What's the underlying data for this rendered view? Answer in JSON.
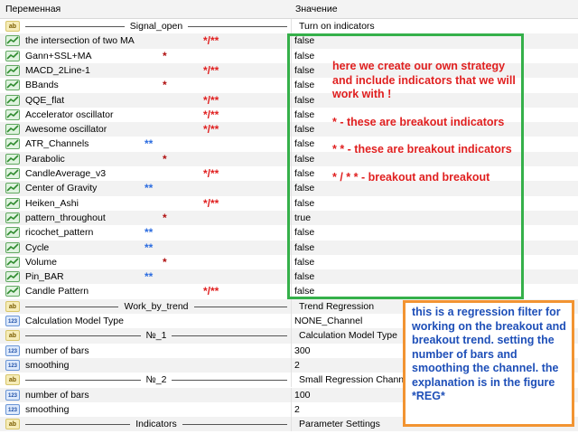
{
  "header": {
    "col_variable": "Переменная",
    "col_value": "Значение"
  },
  "rows": [
    {
      "type": "sep",
      "name": "Signal_open",
      "value": "Turn on indicators"
    },
    {
      "type": "bool",
      "name": "the intersection of two MA",
      "value": "false",
      "mark": "*/**",
      "mark_color": "red"
    },
    {
      "type": "bool",
      "name": "Gann+SSL+MA",
      "value": "false",
      "mark": "*",
      "mark_color": "dark"
    },
    {
      "type": "bool",
      "name": "MACD_2Line-1",
      "value": "false",
      "mark": "*/**",
      "mark_color": "red"
    },
    {
      "type": "bool",
      "name": "BBands",
      "value": "false",
      "mark": "*",
      "mark_color": "dark"
    },
    {
      "type": "bool",
      "name": "QQE_flat",
      "value": "false",
      "mark": "*/**",
      "mark_color": "red"
    },
    {
      "type": "bool",
      "name": "Accelerator oscillator",
      "value": "false",
      "mark": "*/**",
      "mark_color": "red"
    },
    {
      "type": "bool",
      "name": "Awesome oscillator",
      "value": "false",
      "mark": "*/**",
      "mark_color": "red"
    },
    {
      "type": "bool",
      "name": "ATR_Channels",
      "value": "false",
      "mark": "**",
      "mark_color": "blue"
    },
    {
      "type": "bool",
      "name": "Parabolic",
      "value": "false",
      "mark": "*",
      "mark_color": "dark"
    },
    {
      "type": "bool",
      "name": "CandleAverage_v3",
      "value": "false",
      "mark": "*/**",
      "mark_color": "red"
    },
    {
      "type": "bool",
      "name": "Center of Gravity",
      "value": "false",
      "mark": "**",
      "mark_color": "blue"
    },
    {
      "type": "bool",
      "name": "Heiken_Ashi",
      "value": "false",
      "mark": "*/**",
      "mark_color": "red"
    },
    {
      "type": "bool",
      "name": "pattern_throughout",
      "value": "true",
      "mark": "*",
      "mark_color": "dark"
    },
    {
      "type": "bool",
      "name": "ricochet_pattern",
      "value": "false",
      "mark": "**",
      "mark_color": "blue"
    },
    {
      "type": "bool",
      "name": "Cycle",
      "value": "false",
      "mark": "**",
      "mark_color": "blue"
    },
    {
      "type": "bool",
      "name": "Volume",
      "value": "false",
      "mark": "*",
      "mark_color": "dark"
    },
    {
      "type": "bool",
      "name": "Pin_BAR",
      "value": "false",
      "mark": "**",
      "mark_color": "blue"
    },
    {
      "type": "bool",
      "name": "Candle Pattern",
      "value": "false",
      "mark": "*/**",
      "mark_color": "red"
    },
    {
      "type": "sep",
      "name": "Work_by_trend",
      "value": "Trend Regression"
    },
    {
      "type": "num",
      "name": "Calculation Model Type",
      "value": "NONE_Channel"
    },
    {
      "type": "sep",
      "name": "№_1",
      "value": "Calculation Model Type"
    },
    {
      "type": "num",
      "name": "number of bars",
      "value": "300"
    },
    {
      "type": "num",
      "name": "smoothing",
      "value": "2"
    },
    {
      "type": "sep",
      "name": "№_2",
      "value": "Small Regression Channel"
    },
    {
      "type": "num",
      "name": "number of bars",
      "value": "100"
    },
    {
      "type": "num",
      "name": "smoothing",
      "value": "2"
    },
    {
      "type": "sep",
      "name": "Indicators",
      "value": "Parameter Settings"
    }
  ],
  "annotation_green": [
    "here we create our own strategy and include indicators that we will work with !",
    "* - these are breakout indicators",
    "* * - these are breakout indicators",
    "* / * * - breakout and breakout"
  ],
  "annotation_orange": "this is a regression filter for working on the breakout and breakout trend. setting the number of bars and smoothing the channel. the explanation is in the figure *REG*",
  "colors": {
    "green_box": "#35b04a",
    "orange_box": "#f29432",
    "red_text": "#e02020",
    "blue_text": "#1e4fb8"
  }
}
